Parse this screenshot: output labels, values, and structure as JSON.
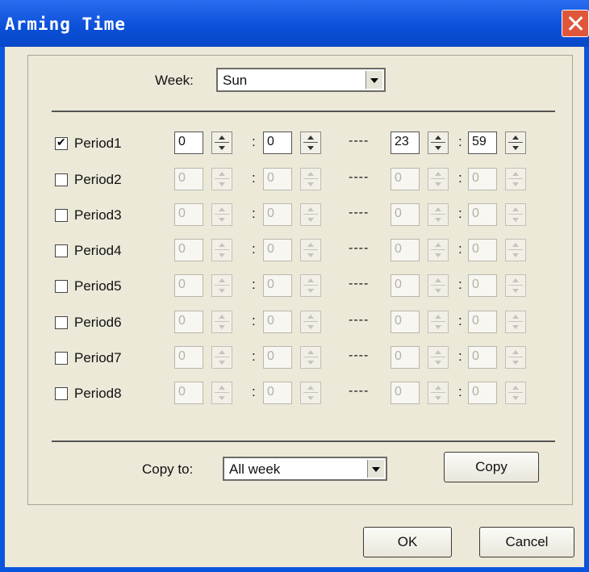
{
  "window": {
    "title": "Arming Time"
  },
  "week": {
    "label": "Week:",
    "value": "Sun"
  },
  "separator": ":",
  "dash": "----",
  "periods": [
    {
      "label": "Period1",
      "checked": true,
      "start_h": "0",
      "start_m": "0",
      "end_h": "23",
      "end_m": "59"
    },
    {
      "label": "Period2",
      "checked": false,
      "start_h": "0",
      "start_m": "0",
      "end_h": "0",
      "end_m": "0"
    },
    {
      "label": "Period3",
      "checked": false,
      "start_h": "0",
      "start_m": "0",
      "end_h": "0",
      "end_m": "0"
    },
    {
      "label": "Period4",
      "checked": false,
      "start_h": "0",
      "start_m": "0",
      "end_h": "0",
      "end_m": "0"
    },
    {
      "label": "Period5",
      "checked": false,
      "start_h": "0",
      "start_m": "0",
      "end_h": "0",
      "end_m": "0"
    },
    {
      "label": "Period6",
      "checked": false,
      "start_h": "0",
      "start_m": "0",
      "end_h": "0",
      "end_m": "0"
    },
    {
      "label": "Period7",
      "checked": false,
      "start_h": "0",
      "start_m": "0",
      "end_h": "0",
      "end_m": "0"
    },
    {
      "label": "Period8",
      "checked": false,
      "start_h": "0",
      "start_m": "0",
      "end_h": "0",
      "end_m": "0"
    }
  ],
  "copy": {
    "label": "Copy to:",
    "value": "All week",
    "button": "Copy"
  },
  "buttons": {
    "ok": "OK",
    "cancel": "Cancel"
  }
}
